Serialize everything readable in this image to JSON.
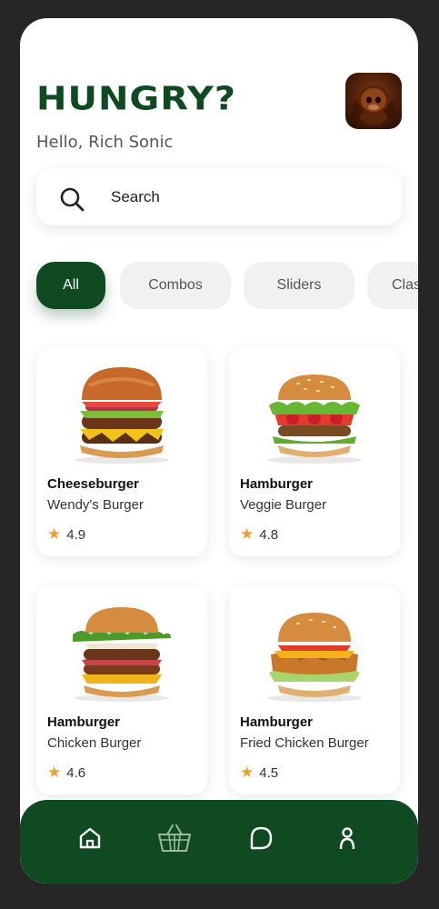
{
  "header": {
    "title": "HUNGRY?",
    "greeting": "Hello, Rich Sonic"
  },
  "search": {
    "placeholder": "Search",
    "value": ""
  },
  "categories": [
    {
      "label": "All",
      "active": true
    },
    {
      "label": "Combos",
      "active": false
    },
    {
      "label": "Sliders",
      "active": false
    },
    {
      "label": "Clas",
      "active": false
    }
  ],
  "products": [
    {
      "name": "Cheeseburger",
      "subtitle": "Wendy's Burger",
      "rating": "4.9"
    },
    {
      "name": "Hamburger",
      "subtitle": "Veggie Burger",
      "rating": "4.8"
    },
    {
      "name": "Hamburger",
      "subtitle": "Chicken Burger",
      "rating": "4.6"
    },
    {
      "name": "Hamburger",
      "subtitle": "Fried Chicken Burger",
      "rating": "4.5"
    }
  ],
  "nav": {
    "items": [
      {
        "icon": "home-icon"
      },
      {
        "icon": "basket-icon"
      },
      {
        "icon": "chat-icon"
      },
      {
        "icon": "profile-icon"
      }
    ]
  },
  "colors": {
    "brand": "#0f4a22",
    "star": "#f0a02a",
    "chip_bg": "#f0f1f2",
    "backdrop": "#262626"
  }
}
